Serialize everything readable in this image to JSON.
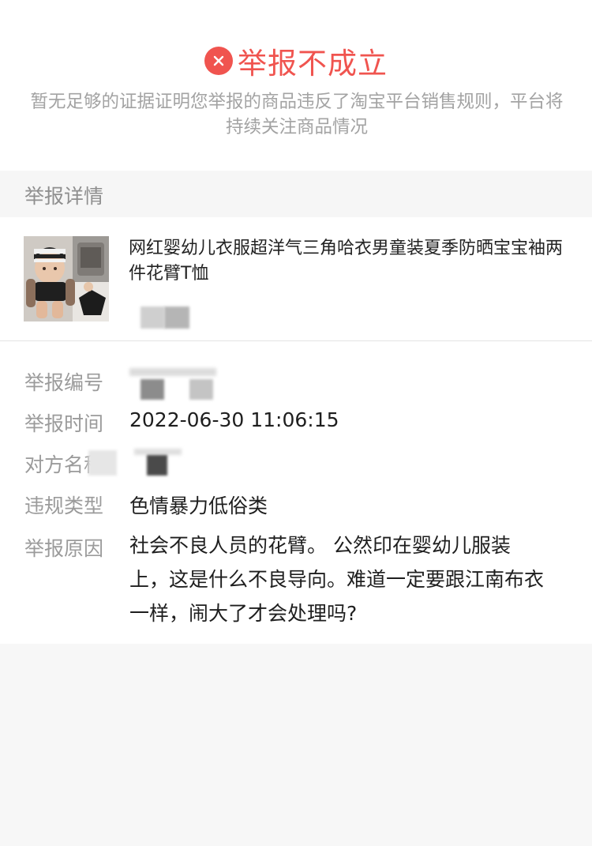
{
  "status": {
    "icon": "close-circle-icon",
    "title": "举报不成立",
    "description": "暂无足够的证据证明您举报的商品违反了淘宝平台销售规则，平台将持续关注商品情况",
    "color": "#f0544f"
  },
  "section": {
    "title": "举报详情"
  },
  "product": {
    "title": "网红婴幼儿衣服超洋气三角哈衣男童装夏季防晒宝宝袖两件花臂T恤"
  },
  "details": {
    "id_label": "举报编号",
    "time_label": "举报时间",
    "time_value": "2022-06-30 11:06:15",
    "party_label": "对方名称",
    "type_label": "违规类型",
    "type_value": "色情暴力低俗类",
    "reason_label": "举报原因",
    "reason_value": "社会不良人员的花臂。 公然印在婴幼儿服装上，这是什么不良导向。难道一定要跟江南布衣一样，闹大了才会处理吗?"
  }
}
